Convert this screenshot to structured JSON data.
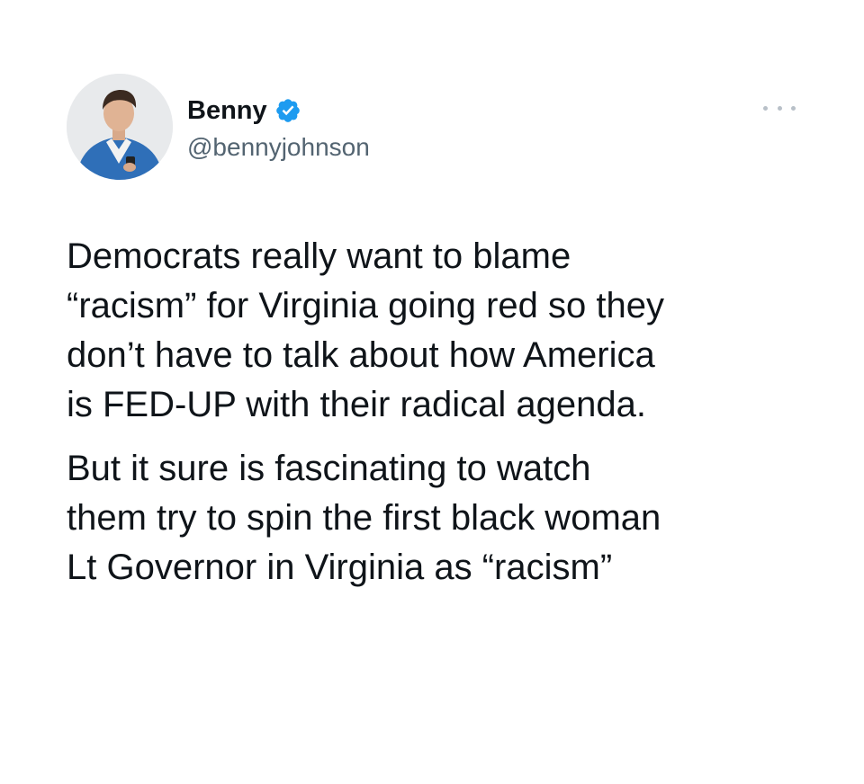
{
  "tweet": {
    "author": {
      "display_name": "Benny",
      "handle": "@bennyjohnson",
      "verified": true,
      "avatar_icon": "profile-photo"
    },
    "more_icon": "ellipsis-icon",
    "paragraphs": [
      "Democrats really want to blame\n“racism” for Virginia going red so they\ndon’t have to talk about how America\nis FED-UP with their radical agenda.",
      "But it sure is fascinating to watch\nthem try to spin the first black woman\nLt Governor in Virginia as “racism”"
    ]
  },
  "colors": {
    "text_primary": "#0f1419",
    "text_secondary": "#536471",
    "verified_blue": "#1d9bf0",
    "background": "#ffffff"
  }
}
